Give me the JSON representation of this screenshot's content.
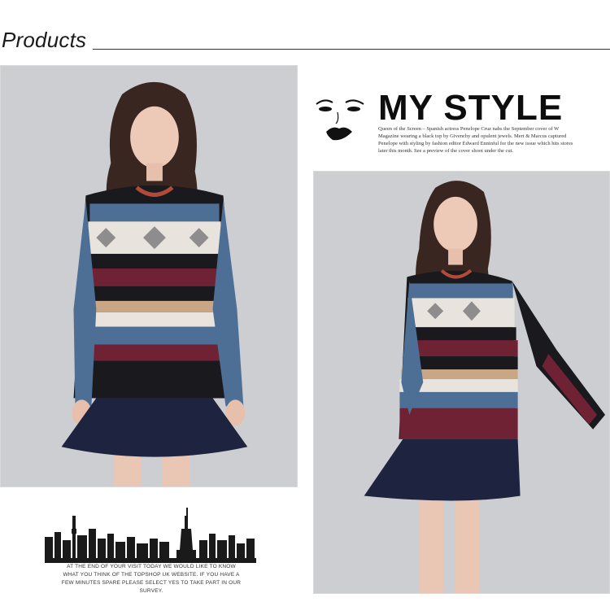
{
  "header": {
    "title": "Products"
  },
  "editorial": {
    "title": "MY STYLE",
    "body": "Queen of the Screen – Spanish actress Penelope Cruz nabs the September cover of W Magazine wearing a black top by Givenchy and opulent jewels. Mert & Marcus captured Penelope with styling by fashion editor Edward Enninful for the new issue which hits stores later this month. See a preview of the cover shoot under the cut.",
    "icon": "lips-face-icon"
  },
  "footer": {
    "survey_text": "AT THE END OF YOUR VISIT TODAY WE WOULD LIKE TO KNOW WHAT YOU THINK OF THE TOPSHOP UK WEBSITE. IF YOU HAVE A FEW MINUTES SPARE PLEASE SELECT YES TO TAKE PART IN OUR SURVEY.",
    "icon": "city-skyline-icon"
  },
  "colors": {
    "background": "#ffffff",
    "photo_bg": "#cfd0d4",
    "skirt": "#1e2340",
    "stripe_blue": "#4d6f96",
    "stripe_burgundy": "#6e2233",
    "stripe_tan": "#c9a684",
    "stripe_cream": "#e8e3dc",
    "stripe_black": "#1a1a1e"
  }
}
